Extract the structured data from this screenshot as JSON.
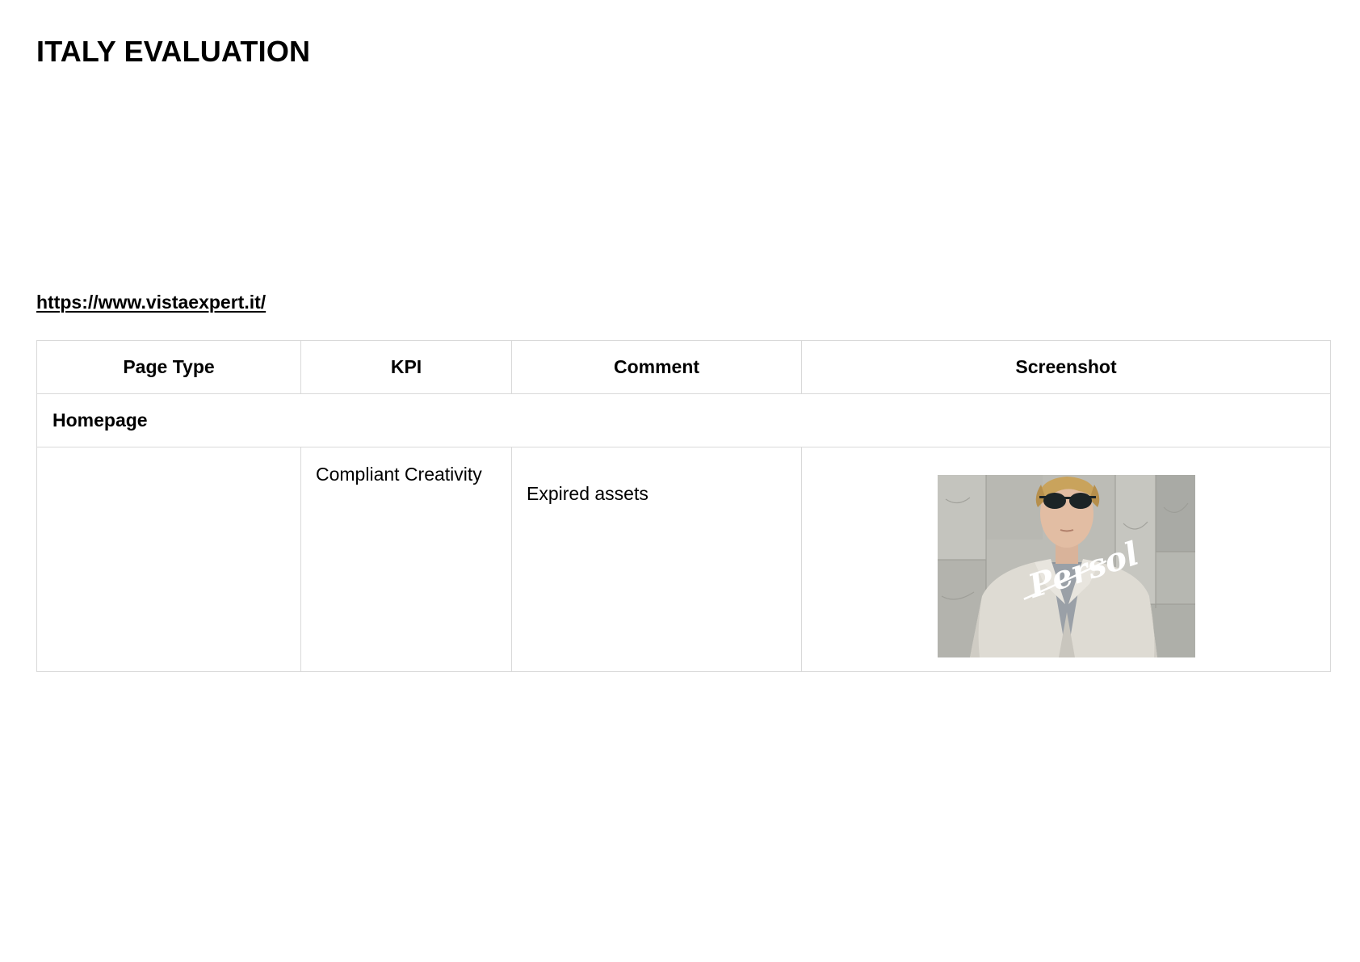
{
  "document": {
    "title": "ITALY EVALUATION",
    "link": "https://www.vistaexpert.it/"
  },
  "table": {
    "headers": [
      "Page Type",
      "KPI",
      "Comment",
      "Screenshot"
    ],
    "sections": [
      {
        "name": "Homepage",
        "rows": [
          {
            "page_type": "",
            "kpi": "Compliant Creativity",
            "comment": "Expired assets",
            "screenshot": {
              "description_icon": "persol-campaign-image",
              "logo_text": "Persol"
            }
          }
        ]
      }
    ]
  },
  "colors": {
    "border": "#d9d9d9",
    "text": "#000000",
    "background": "#ffffff"
  }
}
